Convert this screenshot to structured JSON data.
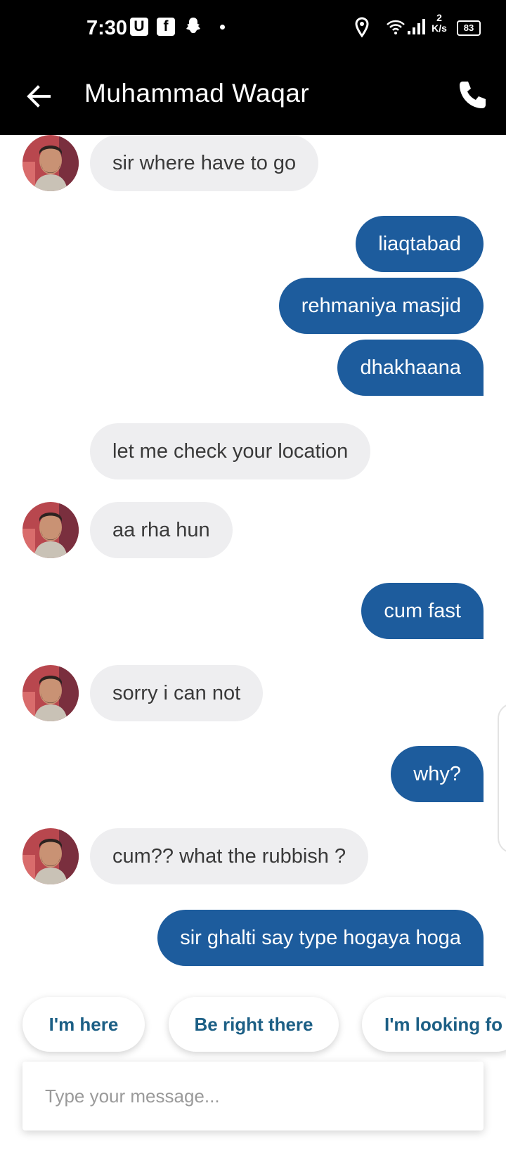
{
  "status_bar": {
    "time": "7:30",
    "badge_u": "U",
    "badge_f": "f",
    "network_speed_value": "2",
    "network_speed_unit": "K/s",
    "battery": "83"
  },
  "header": {
    "title": "Muhammad Waqar",
    "back_icon": "arrow-left-icon",
    "call_icon": "phone-icon"
  },
  "messages": [
    {
      "from": "driver",
      "text": "sir where have to go",
      "avatar": true
    },
    {
      "from": "me",
      "text": "liaqtabad"
    },
    {
      "from": "me",
      "text": "rehmaniya masjid"
    },
    {
      "from": "me",
      "text": "dhakhaana"
    },
    {
      "from": "driver",
      "text": "let me check your location",
      "avatar": false
    },
    {
      "from": "driver",
      "text": "aa rha hun",
      "avatar": true
    },
    {
      "from": "me",
      "text": "cum fast"
    },
    {
      "from": "driver",
      "text": "sorry i can  not",
      "avatar": true
    },
    {
      "from": "me",
      "text": "why?"
    },
    {
      "from": "driver",
      "text": "cum?? what the rubbish ?",
      "avatar": true
    },
    {
      "from": "me",
      "text": "sir ghalti say type hogaya hoga"
    }
  ],
  "quick_replies": [
    "I'm here",
    "Be right there",
    "I'm looking fo"
  ],
  "composer": {
    "placeholder": "Type your message..."
  },
  "colors": {
    "outgoing_bubble": "#1d5c9d",
    "incoming_bubble": "#eeeef0",
    "quick_reply_text": "#1c5f85",
    "bars": "#000000"
  }
}
